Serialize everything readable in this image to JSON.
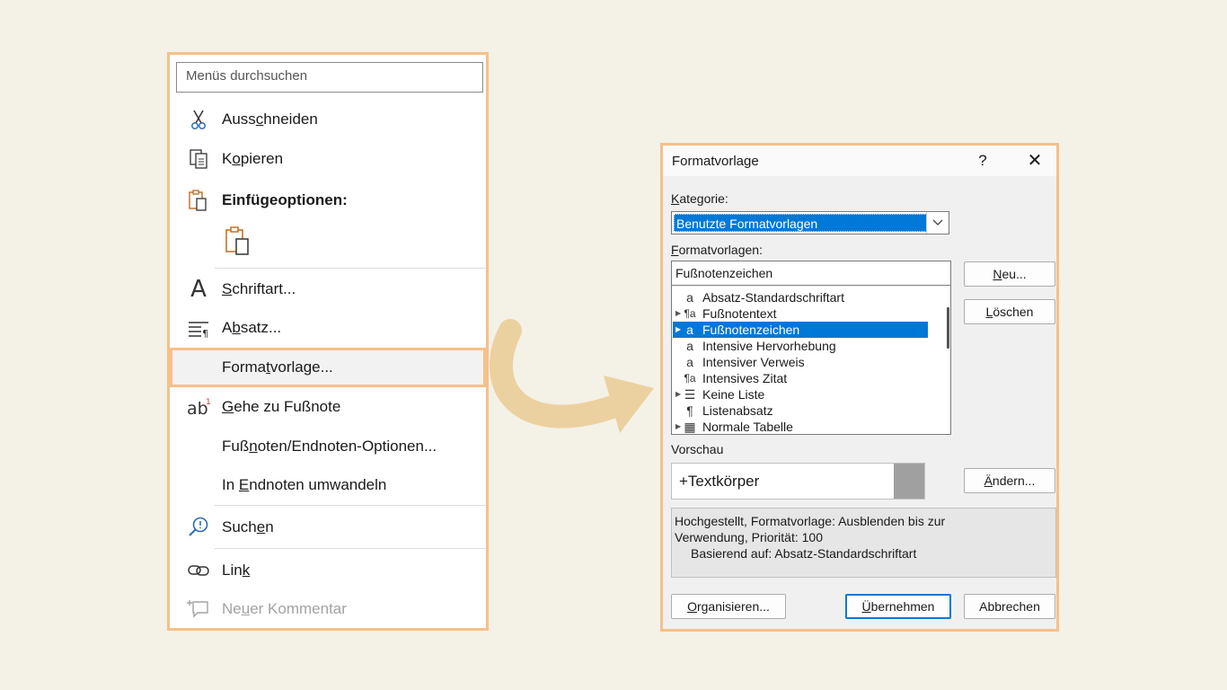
{
  "menu": {
    "search_placeholder": "Menüs durchsuchen",
    "items": [
      {
        "pre": "Auss",
        "ul": "c",
        "post": "hneiden",
        "icon": "scissors-icon"
      },
      {
        "pre": "K",
        "ul": "o",
        "post": "pieren",
        "icon": "copy-icon"
      },
      {
        "pre": "",
        "ul": "",
        "post": "Einfügeoptionen:",
        "icon": "paste-icon"
      },
      {
        "pre": "",
        "ul": "S",
        "post": "chriftart...",
        "icon": "font-icon"
      },
      {
        "pre": "A",
        "ul": "b",
        "post": "satz...",
        "icon": "paragraph-icon"
      },
      {
        "pre": "Forma",
        "ul": "t",
        "post": "vorlage...",
        "icon": ""
      },
      {
        "pre": "",
        "ul": "G",
        "post": "ehe zu Fußnote",
        "icon": "footnote-icon"
      },
      {
        "pre": "Fuß",
        "ul": "n",
        "post": "oten/Endnoten-Optionen...",
        "icon": ""
      },
      {
        "pre": "In ",
        "ul": "E",
        "post": "ndnoten umwandeln",
        "icon": ""
      },
      {
        "pre": "Such",
        "ul": "e",
        "post": "n",
        "icon": "smart-lookup-icon"
      },
      {
        "pre": "Lin",
        "ul": "k",
        "post": "",
        "icon": "link-icon"
      },
      {
        "pre": "Ne",
        "ul": "u",
        "post": "er Kommentar",
        "icon": "new-comment-icon"
      }
    ]
  },
  "dialog": {
    "title": "Formatvorlage",
    "help": "?",
    "close": "✕",
    "category_label_ul": "K",
    "category_label_rest": "ategorie:",
    "category_value": "Benutzte Formatvorlagen",
    "styles_label_ul": "F",
    "styles_label_rest": "ormatvorlagen:",
    "styles_input": "Fußnotenzeichen",
    "styles": [
      {
        "exp": "",
        "sym": "a",
        "name": "Absatz-Standardschriftart"
      },
      {
        "exp": "▶",
        "sym": "¶a",
        "name": "Fußnotentext"
      },
      {
        "exp": "▶",
        "sym": "a",
        "name": "Fußnotenzeichen"
      },
      {
        "exp": "",
        "sym": "a",
        "name": "Intensive Hervorhebung"
      },
      {
        "exp": "",
        "sym": "a",
        "name": "Intensiver Verweis"
      },
      {
        "exp": "",
        "sym": "¶a",
        "name": "Intensives Zitat"
      },
      {
        "exp": "▶",
        "sym": "☰",
        "name": "Keine Liste"
      },
      {
        "exp": "",
        "sym": "¶",
        "name": "Listenabsatz"
      },
      {
        "exp": "▶",
        "sym": "▦",
        "name": "Normale Tabelle"
      }
    ],
    "selected_index": 2,
    "btn_new_ul": "N",
    "btn_new_rest": "eu...",
    "btn_delete_ul": "L",
    "btn_delete_rest": "öschen",
    "preview_label": "Vorschau",
    "preview_text": "+Textkörper",
    "btn_modify_ul": "Ä",
    "btn_modify_rest": "ndern...",
    "description_1": "Hochgestellt, Formatvorlage: Ausblenden bis zur",
    "description_2": "Verwendung, Priorität: 100",
    "description_3": "Basierend auf: Absatz-Standardschriftart",
    "btn_organize_ul": "O",
    "btn_organize_rest": "rganisieren...",
    "btn_apply_ul": "Ü",
    "btn_apply_rest": "bernehmen",
    "btn_cancel": "Abbrechen"
  },
  "colors": {
    "accent": "#f6c088",
    "selection": "#0078d7",
    "arrow": "#ecd1a0"
  }
}
